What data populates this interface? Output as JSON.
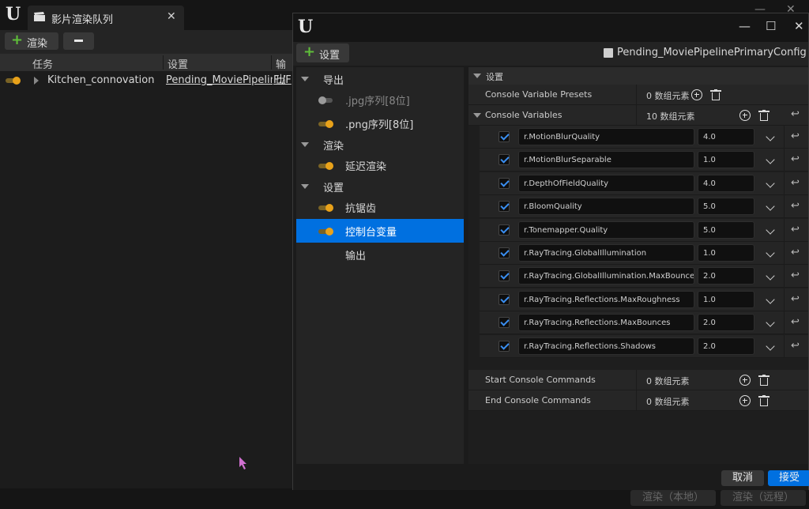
{
  "main_window": {
    "tab_title": "影片渲染队列",
    "toolbar": {
      "render_label": "渲染"
    },
    "columns": [
      "任务",
      "设置",
      "输出"
    ],
    "jobs": [
      {
        "name": "Kitchen_connovation",
        "settings": "Pending_MoviePipelinePr",
        "output": "F:/F"
      }
    ],
    "bottom_buttons": {
      "render_local": "渲染（本地）",
      "render_remote": "渲染（远程）"
    }
  },
  "dialog": {
    "toolbar": {
      "settings_label": "设置"
    },
    "config_name": "Pending_MoviePipelinePrimaryConfig",
    "config_suffix": "*",
    "tree": [
      {
        "label": "导出"
      },
      {
        "label": ".jpg序列[8位]"
      },
      {
        "label": ".png序列[8位]"
      },
      {
        "label": "渲染"
      },
      {
        "label": "延迟渲染"
      },
      {
        "label": "设置"
      },
      {
        "label": "抗锯齿"
      },
      {
        "label": "控制台变量"
      },
      {
        "label": "输出"
      }
    ],
    "section_title": "设置",
    "presets": {
      "label": "Console Variable Presets",
      "value": "0 数组元素"
    },
    "variables": {
      "label": "Console Variables",
      "value": "10 数组元素"
    },
    "cvars": [
      {
        "name": "r.MotionBlurQuality",
        "value": "4.0"
      },
      {
        "name": "r.MotionBlurSeparable",
        "value": "1.0"
      },
      {
        "name": "r.DepthOfFieldQuality",
        "value": "4.0"
      },
      {
        "name": "r.BloomQuality",
        "value": "5.0"
      },
      {
        "name": "r.Tonemapper.Quality",
        "value": "5.0"
      },
      {
        "name": "r.RayTracing.GlobalIllumination",
        "value": "1.0"
      },
      {
        "name": "r.RayTracing.GlobalIllumination.MaxBounces",
        "value": "2.0"
      },
      {
        "name": "r.RayTracing.Reflections.MaxRoughness",
        "value": "1.0"
      },
      {
        "name": "r.RayTracing.Reflections.MaxBounces",
        "value": "2.0"
      },
      {
        "name": "r.RayTracing.Reflections.Shadows",
        "value": "2.0"
      }
    ],
    "start_commands": {
      "label": "Start Console Commands",
      "value": "0 数组元素"
    },
    "end_commands": {
      "label": "End Console Commands",
      "value": "0 数组元素"
    },
    "footer": {
      "cancel": "取消",
      "accept": "接受"
    },
    "colors": {
      "accent": "#0070e0",
      "toggle_on": "#e9a21a",
      "add_green": "#5fbf3a"
    }
  }
}
